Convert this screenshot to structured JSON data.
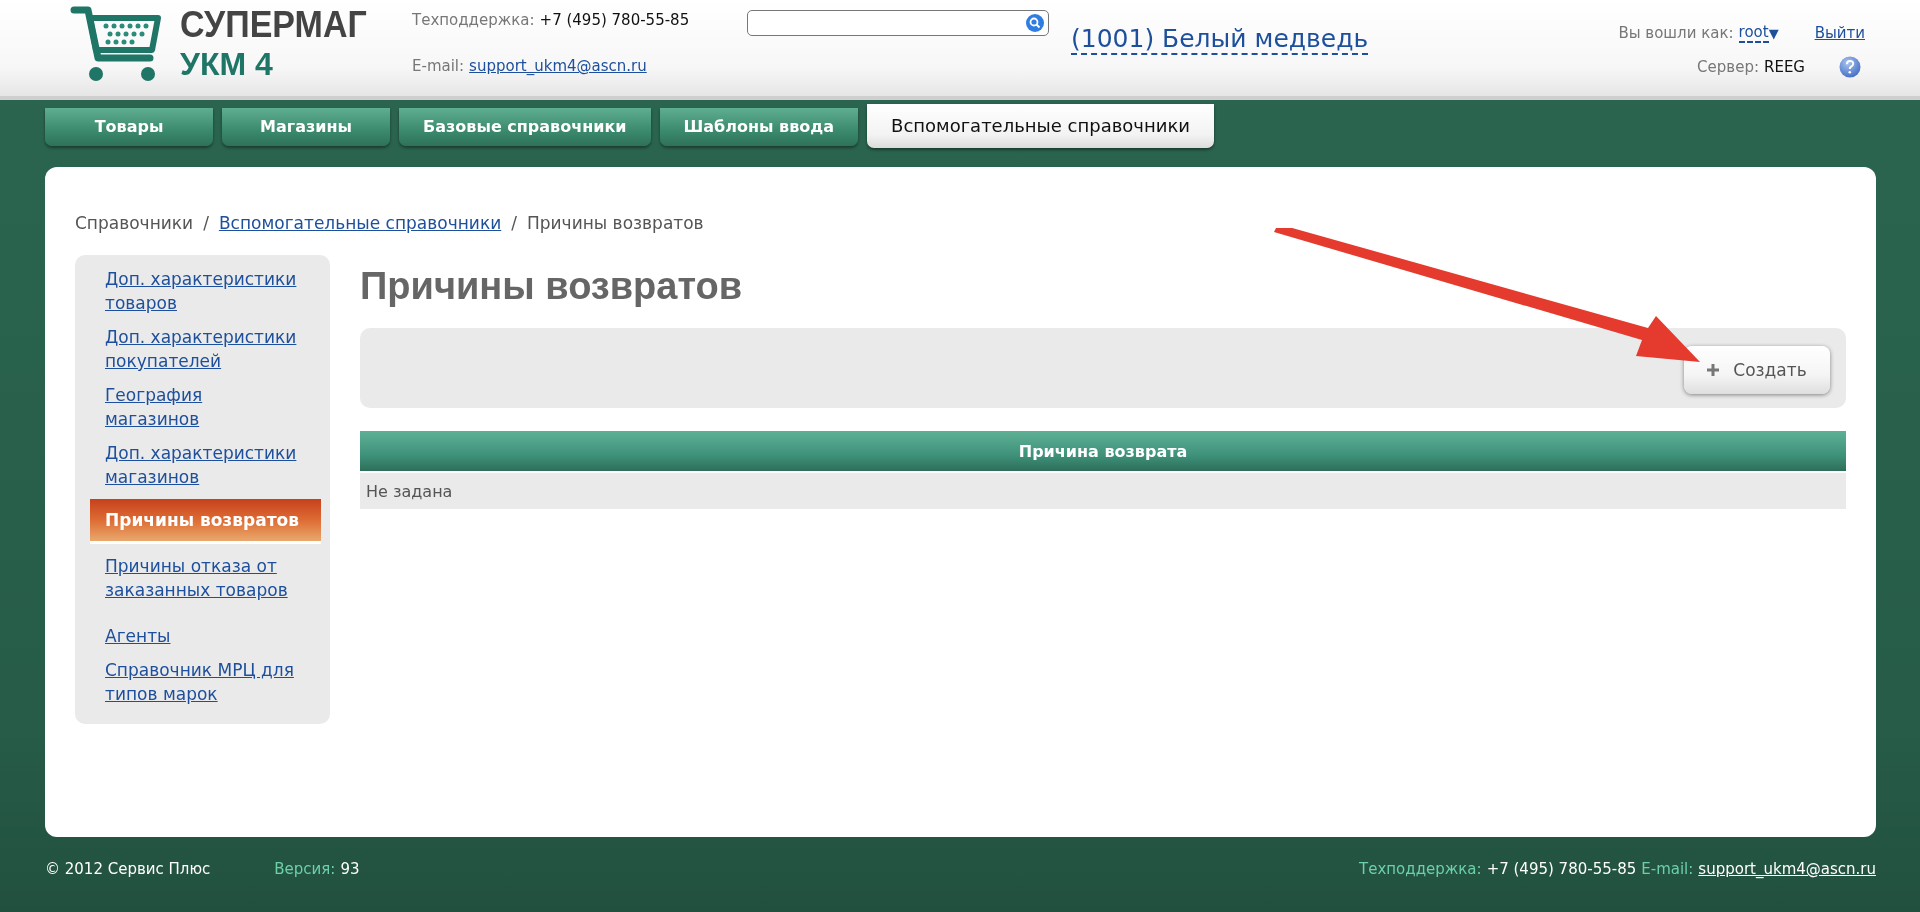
{
  "header": {
    "logo": {
      "title": "СУПЕРМАГ",
      "subtitle": "УКМ 4"
    },
    "support": {
      "label": "Техподдержка:",
      "phone": "+7 (495) 780-55-85"
    },
    "email": {
      "label": "E-mail:",
      "address": "support_ukm4@ascn.ru"
    },
    "store": "(1001) Белый медведь",
    "user": {
      "label": "Вы вошли как:",
      "name": "root",
      "caret": "▼"
    },
    "logout": "Выйти",
    "server": {
      "label": "Сервер:",
      "name": "REEG"
    }
  },
  "tabs": [
    {
      "label": "Товары",
      "selected": false
    },
    {
      "label": "Магазины",
      "selected": false
    },
    {
      "label": "Базовые справочники",
      "selected": false
    },
    {
      "label": "Шаблоны ввода",
      "selected": false
    },
    {
      "label": "Вспомогательные справочники",
      "selected": true
    }
  ],
  "breadcrumb_separator": "/",
  "breadcrumb": [
    {
      "label": "Справочники",
      "kind": "text"
    },
    {
      "label": "Вспомогательные справочники",
      "kind": "link"
    },
    {
      "label": "Причины возвратов",
      "kind": "text"
    }
  ],
  "sidebar": {
    "items": [
      {
        "label": "Доп. характеристики товаров",
        "selected": false
      },
      {
        "label": "Доп. характеристики покупателей",
        "selected": false
      },
      {
        "label": "География магазинов",
        "selected": false
      },
      {
        "label": "Доп. характеристики магазинов",
        "selected": false
      },
      {
        "label": "Причины возвратов",
        "selected": true
      },
      {
        "label": "Причины отказа от заказанных товаров",
        "selected": false
      },
      {
        "label": "Агенты",
        "selected": false
      },
      {
        "label": "Справочник МРЦ для типов марок",
        "selected": false
      }
    ]
  },
  "page_title": "Причины возвратов",
  "toolbar": {
    "create_button": "Создать"
  },
  "table": {
    "columns": [
      "Причина возврата"
    ],
    "rows": [
      [
        "Не задана"
      ]
    ]
  },
  "footer": {
    "copyright": "© 2012 Сервис Плюс",
    "version": {
      "label": "Версия:",
      "value": "93"
    },
    "support": {
      "label": "Техподдержка:",
      "phone": "+7 (495) 780-55-85"
    },
    "email": {
      "label": "E-mail:",
      "address": "support_ukm4@ascn.ru"
    }
  }
}
